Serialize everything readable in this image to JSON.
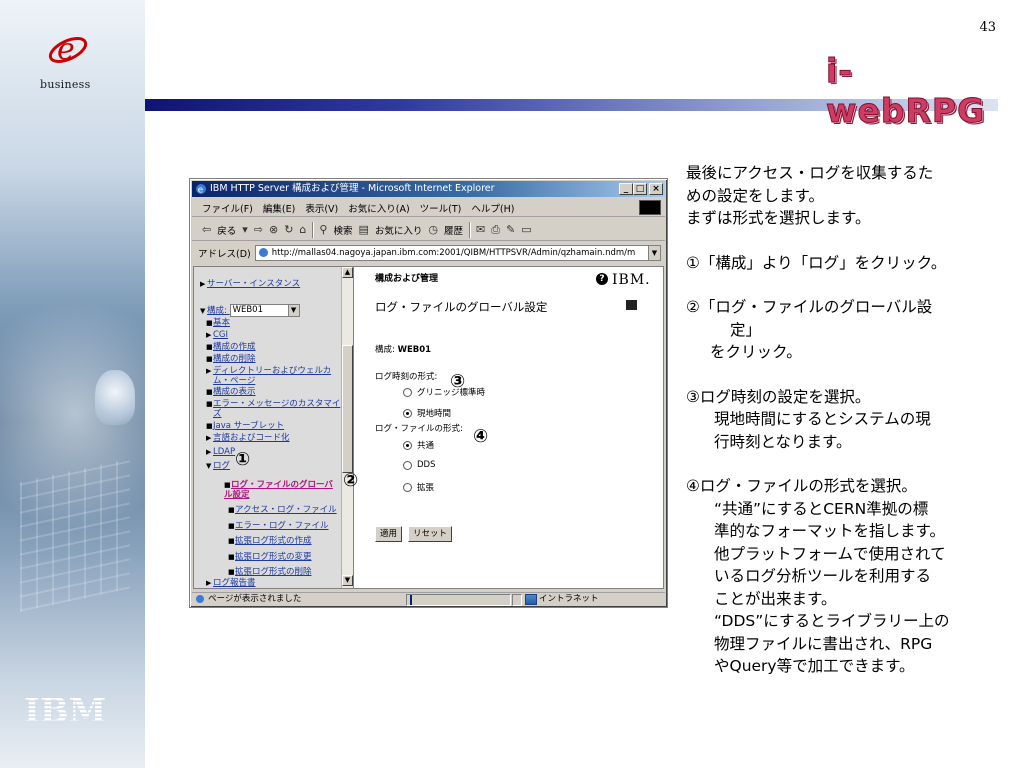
{
  "slide": {
    "page_number": "43",
    "brand": "i-webRPG",
    "left_logo_caption": "business",
    "bottom_logo_text": "IBM"
  },
  "browser": {
    "title": "IBM HTTP Server 構成および管理 - Microsoft Internet Explorer",
    "window_buttons": [
      "_",
      "□",
      "×"
    ],
    "menu": [
      "ファイル(F)",
      "編集(E)",
      "表示(V)",
      "お気に入り(A)",
      "ツール(T)",
      "ヘルプ(H)"
    ],
    "toolbar": {
      "back": "戻る",
      "search": "検索",
      "favorites": "お気に入り",
      "history": "履歴"
    },
    "address_label": "アドレス(D)",
    "address_url": "http://mallas04.nagoya.japan.ibm.com:2001/QIBM/HTTPSVR/Admin/qzhamain.ndm/m",
    "status_text": "ページが表示されました",
    "status_zone": "イントラネット"
  },
  "nav": {
    "server_instance": "サーバー・インスタンス",
    "config_label": "構成:",
    "config_value": "WEB01",
    "items": [
      "基本",
      "CGI",
      "構成の作成",
      "構成の削除",
      "ディレクトリーおよびウェルカ",
      "ム・ページ",
      "構成の表示",
      "エラー・メッセージのカスタマイ",
      "ズ",
      "Java サーブレット",
      "言語およびコード化",
      "LDAP",
      "ログ"
    ],
    "log_sub_active_1": "ログ・ファイルのグローバ",
    "log_sub_active_2": "ル設定",
    "log_subitems": [
      "アクセス・ログ・ファイル",
      "エラー・ログ・ファイル",
      "拡張ログ形式の作成",
      "拡張ログ形式の変更",
      "拡張ログ形式の削除"
    ],
    "last_item": "ログ報告書"
  },
  "main": {
    "section_title": "構成および管理",
    "ibm_mark": "IBM.",
    "heading": "ログ・ファイルのグローバル設定",
    "config_prefix": "構成:",
    "config_name": "WEB01",
    "time_format_label": "ログ時刻の形式:",
    "time_options": [
      {
        "label": "グリニッジ標準時",
        "selected": false
      },
      {
        "label": "現地時間",
        "selected": true
      }
    ],
    "file_format_label": "ログ・ファイルの形式:",
    "file_options": [
      {
        "label": "共通",
        "selected": true
      },
      {
        "label": "DDS",
        "selected": false
      },
      {
        "label": "拡張",
        "selected": false
      }
    ],
    "apply_button": "適用",
    "reset_button": "リセット"
  },
  "markers": {
    "m1": "①",
    "m2": "②",
    "m3": "③",
    "m4": "④"
  },
  "notes": {
    "intro": [
      "最後にアクセス・ログを収集するた",
      "めの設定をします。",
      "まずは形式を選択します。"
    ],
    "step1": "①「構成」より「ログ」をクリック。",
    "step2": [
      "②「ログ・ファイルのグローバル設",
      "定」",
      "をクリック。"
    ],
    "step3": [
      "③ログ時刻の設定を選択。",
      "現地時間にするとシステムの現",
      "行時刻となります。"
    ],
    "step4": [
      "④ログ・ファイルの形式を選択。",
      "“共通”にするとCERN準拠の標",
      "準的なフォーマットを指します。",
      "他プラットフォームで使用されて",
      "いるログ分析ツールを利用する",
      "ことが出来ます。",
      "“DDS”にするとライブラリー上の",
      "物理ファイルに書出され、RPG",
      "やQuery等で加工できます。"
    ]
  },
  "colors": {
    "brand": "#cf3c63",
    "header_rule": "#0e1472",
    "link": "#1e3aa0",
    "active_link": "#b0127e",
    "titlebar": "#0a246a"
  }
}
